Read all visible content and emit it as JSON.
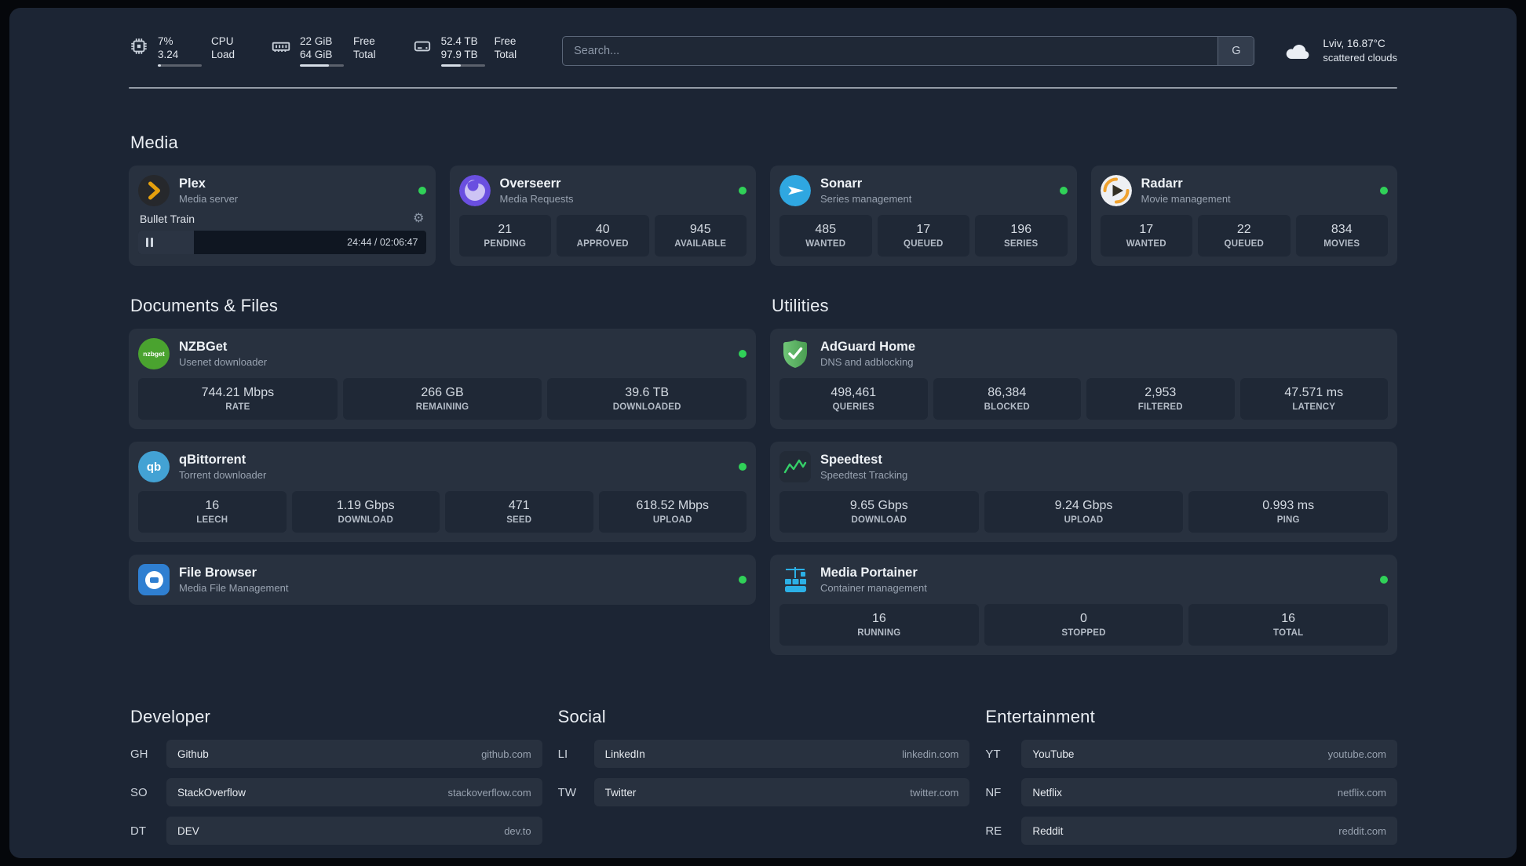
{
  "topbar": {
    "cpu": {
      "percent": "7%",
      "load": "3.24",
      "label_top": "CPU",
      "label_bottom": "Load",
      "bar_pct": 7
    },
    "memory": {
      "free": "22 GiB",
      "total": "64 GiB",
      "label_top": "Free",
      "label_bottom": "Total",
      "bar_pct": 66
    },
    "disk": {
      "free": "52.4 TB",
      "total": "97.9 TB",
      "label_top": "Free",
      "label_bottom": "Total",
      "bar_pct": 46
    },
    "search": {
      "placeholder": "Search...",
      "provider": "G"
    },
    "weather": {
      "location": "Lviv, 16.87°C",
      "condition": "scattered clouds"
    }
  },
  "sections": {
    "media": {
      "title": "Media"
    },
    "documents": {
      "title": "Documents & Files"
    },
    "utilities": {
      "title": "Utilities"
    }
  },
  "services": {
    "plex": {
      "name": "Plex",
      "subtitle": "Media server",
      "status": "online",
      "player": {
        "title": "Bullet Train",
        "time": "24:44 / 02:06:47",
        "progress_pct": 19.5
      }
    },
    "overseerr": {
      "name": "Overseerr",
      "subtitle": "Media Requests",
      "status": "online",
      "stats": [
        {
          "value": "21",
          "label": "PENDING"
        },
        {
          "value": "40",
          "label": "APPROVED"
        },
        {
          "value": "945",
          "label": "AVAILABLE"
        }
      ]
    },
    "sonarr": {
      "name": "Sonarr",
      "subtitle": "Series management",
      "status": "online",
      "stats": [
        {
          "value": "485",
          "label": "WANTED"
        },
        {
          "value": "17",
          "label": "QUEUED"
        },
        {
          "value": "196",
          "label": "SERIES"
        }
      ]
    },
    "radarr": {
      "name": "Radarr",
      "subtitle": "Movie management",
      "status": "online",
      "stats": [
        {
          "value": "17",
          "label": "WANTED"
        },
        {
          "value": "22",
          "label": "QUEUED"
        },
        {
          "value": "834",
          "label": "MOVIES"
        }
      ]
    },
    "nzbget": {
      "name": "NZBGet",
      "subtitle": "Usenet downloader",
      "status": "online",
      "stats": [
        {
          "value": "744.21 Mbps",
          "label": "RATE"
        },
        {
          "value": "266 GB",
          "label": "REMAINING"
        },
        {
          "value": "39.6 TB",
          "label": "DOWNLOADED"
        }
      ]
    },
    "qbittorrent": {
      "name": "qBittorrent",
      "subtitle": "Torrent downloader",
      "status": "online",
      "stats": [
        {
          "value": "16",
          "label": "LEECH"
        },
        {
          "value": "1.19 Gbps",
          "label": "DOWNLOAD"
        },
        {
          "value": "471",
          "label": "SEED"
        },
        {
          "value": "618.52 Mbps",
          "label": "UPLOAD"
        }
      ]
    },
    "filebrowser": {
      "name": "File Browser",
      "subtitle": "Media File Management",
      "status": "online"
    },
    "adguard": {
      "name": "AdGuard Home",
      "subtitle": "DNS and adblocking",
      "stats": [
        {
          "value": "498,461",
          "label": "QUERIES"
        },
        {
          "value": "86,384",
          "label": "BLOCKED"
        },
        {
          "value": "2,953",
          "label": "FILTERED"
        },
        {
          "value": "47.571 ms",
          "label": "LATENCY"
        }
      ]
    },
    "speedtest": {
      "name": "Speedtest",
      "subtitle": "Speedtest Tracking",
      "stats": [
        {
          "value": "9.65 Gbps",
          "label": "DOWNLOAD"
        },
        {
          "value": "9.24 Gbps",
          "label": "UPLOAD"
        },
        {
          "value": "0.993 ms",
          "label": "PING"
        }
      ]
    },
    "portainer": {
      "name": "Media Portainer",
      "subtitle": "Container management",
      "status": "online",
      "stats": [
        {
          "value": "16",
          "label": "RUNNING"
        },
        {
          "value": "0",
          "label": "STOPPED"
        },
        {
          "value": "16",
          "label": "TOTAL"
        }
      ]
    }
  },
  "bookmarks": {
    "developer": {
      "title": "Developer",
      "items": [
        {
          "abbr": "GH",
          "name": "Github",
          "url": "github.com"
        },
        {
          "abbr": "SO",
          "name": "StackOverflow",
          "url": "stackoverflow.com"
        },
        {
          "abbr": "DT",
          "name": "DEV",
          "url": "dev.to"
        }
      ]
    },
    "social": {
      "title": "Social",
      "items": [
        {
          "abbr": "LI",
          "name": "LinkedIn",
          "url": "linkedin.com"
        },
        {
          "abbr": "TW",
          "name": "Twitter",
          "url": "twitter.com"
        }
      ]
    },
    "entertainment": {
      "title": "Entertainment",
      "items": [
        {
          "abbr": "YT",
          "name": "YouTube",
          "url": "youtube.com"
        },
        {
          "abbr": "NF",
          "name": "Netflix",
          "url": "netflix.com"
        },
        {
          "abbr": "RE",
          "name": "Reddit",
          "url": "reddit.com"
        }
      ]
    }
  },
  "colors": {
    "page_bg": "#1c2534",
    "card_bg": "#28313f",
    "tile_bg": "#1f2836",
    "status_online": "#30d158",
    "plex_amber": "#e5a00d",
    "overseerr_purple": "#6a4fe0",
    "sonarr_blue": "#2fa7e1",
    "radarr_amber": "#f0a22e",
    "nzbget_green": "#4aa32f",
    "qbittorrent_blue": "#43a2d4",
    "filebrowser_blue": "#2f7fd1",
    "adguard_green": "#5fb85f",
    "speedtest_green": "#35d069",
    "portainer_blue": "#2cb0e6"
  },
  "icons": {
    "cpu": "chip-outline",
    "memory": "ram-stick-outline",
    "disk": "hard-drive-outline",
    "weather": "cloud",
    "settings": "gear ⚙",
    "player_state": "pause-bars"
  }
}
